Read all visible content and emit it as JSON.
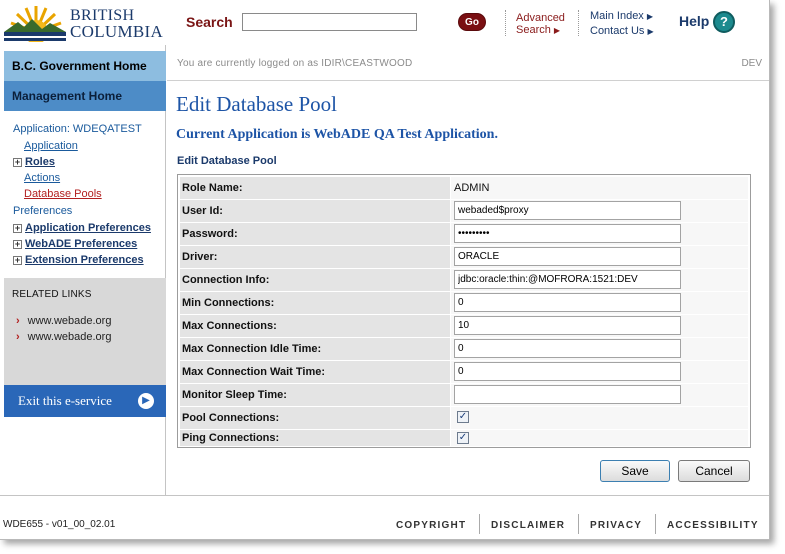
{
  "header": {
    "logo_line1": "BRITISH",
    "logo_line2": "COLUMBIA",
    "search_label": "Search",
    "search_value": "",
    "go_label": "Go",
    "advanced_line1": "Advanced",
    "advanced_line2": "Search",
    "main_index": "Main Index",
    "contact_us": "Contact Us",
    "help_label": "Help",
    "help_icon": "?"
  },
  "nav": {
    "gov_home": "B.C. Government Home",
    "management_home": "Management Home",
    "application_heading": "Application: WDEQATEST",
    "application_link": "Application",
    "roles": "Roles",
    "actions": "Actions",
    "database_pools": "Database Pools",
    "preferences": "Preferences",
    "application_preferences": "Application Preferences",
    "webade_preferences": "WebADE Preferences",
    "extension_preferences": "Extension Preferences",
    "related_title": "RELATED LINKS",
    "related_links": [
      "www.webade.org",
      "www.webade.org"
    ],
    "exit_label": "Exit this e-service"
  },
  "content": {
    "logged_on": "You are currently logged on as IDIR\\CEASTWOOD",
    "environment": "DEV",
    "page_title": "Edit Database Pool",
    "app_heading": "Current Application is WebADE QA Test Application.",
    "section_heading": "Edit Database Pool"
  },
  "form": {
    "role_name_label": "Role Name:",
    "role_name_value": "ADMIN",
    "user_id_label": "User Id:",
    "user_id_value": "webaded$proxy",
    "password_label": "Password:",
    "password_value": "•••••••••",
    "driver_label": "Driver:",
    "driver_value": "ORACLE",
    "connection_info_label": "Connection Info:",
    "connection_info_value": "jdbc:oracle:thin:@MOFRORA:1521:DEV",
    "min_connections_label": "Min Connections:",
    "min_connections_value": "0",
    "max_connections_label": "Max Connections:",
    "max_connections_value": "10",
    "max_idle_label": "Max Connection Idle Time:",
    "max_idle_value": "0",
    "max_wait_label": "Max Connection Wait Time:",
    "max_wait_value": "0",
    "monitor_sleep_label": "Monitor Sleep Time:",
    "monitor_sleep_value": "",
    "pool_connections_label": "Pool Connections:",
    "pool_connections_checked": true,
    "ping_connections_label": "Ping Connections:",
    "ping_connections_checked": true,
    "check_glyph": "✓",
    "save_label": "Save",
    "cancel_label": "Cancel"
  },
  "footer": {
    "build": "WDE655 - v01_00_02.01",
    "copyright": "COPYRIGHT",
    "disclaimer": "DISCLAIMER",
    "privacy": "PRIVACY",
    "accessibility": "ACCESSIBILITY"
  },
  "colors": {
    "brand_blue": "#1d54a6",
    "nav_light_blue": "#8dbde0",
    "nav_mid_blue": "#4d8cc7",
    "exit_blue": "#2a67b8",
    "go_red": "#7a0f12",
    "link_red": "#b21f1f"
  }
}
